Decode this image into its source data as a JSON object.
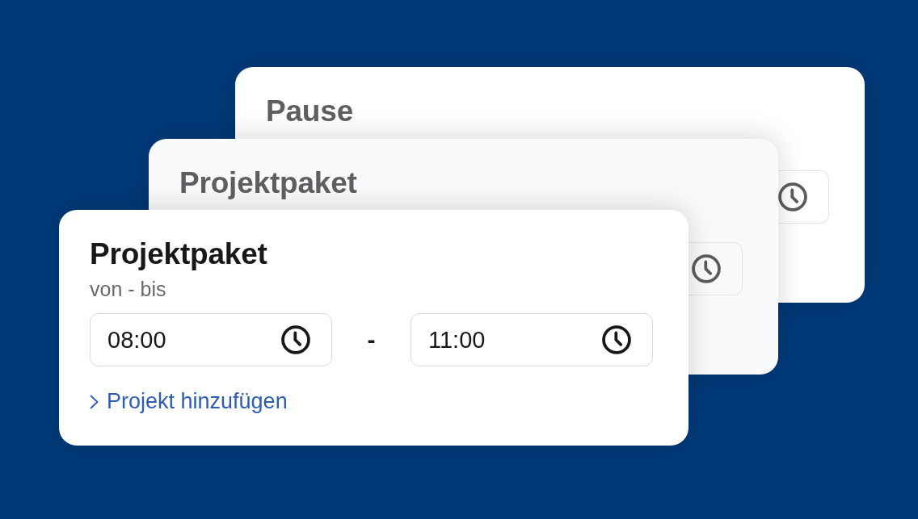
{
  "cards": [
    {
      "kind": "back",
      "title": "Pause"
    },
    {
      "kind": "back",
      "title": "Projektpaket"
    },
    {
      "kind": "front",
      "title": "Projektpaket",
      "subtitle": "von - bis",
      "start_time": "08:00",
      "separator": "-",
      "end_time": "11:00",
      "link": "Projekt hinzufügen"
    }
  ]
}
